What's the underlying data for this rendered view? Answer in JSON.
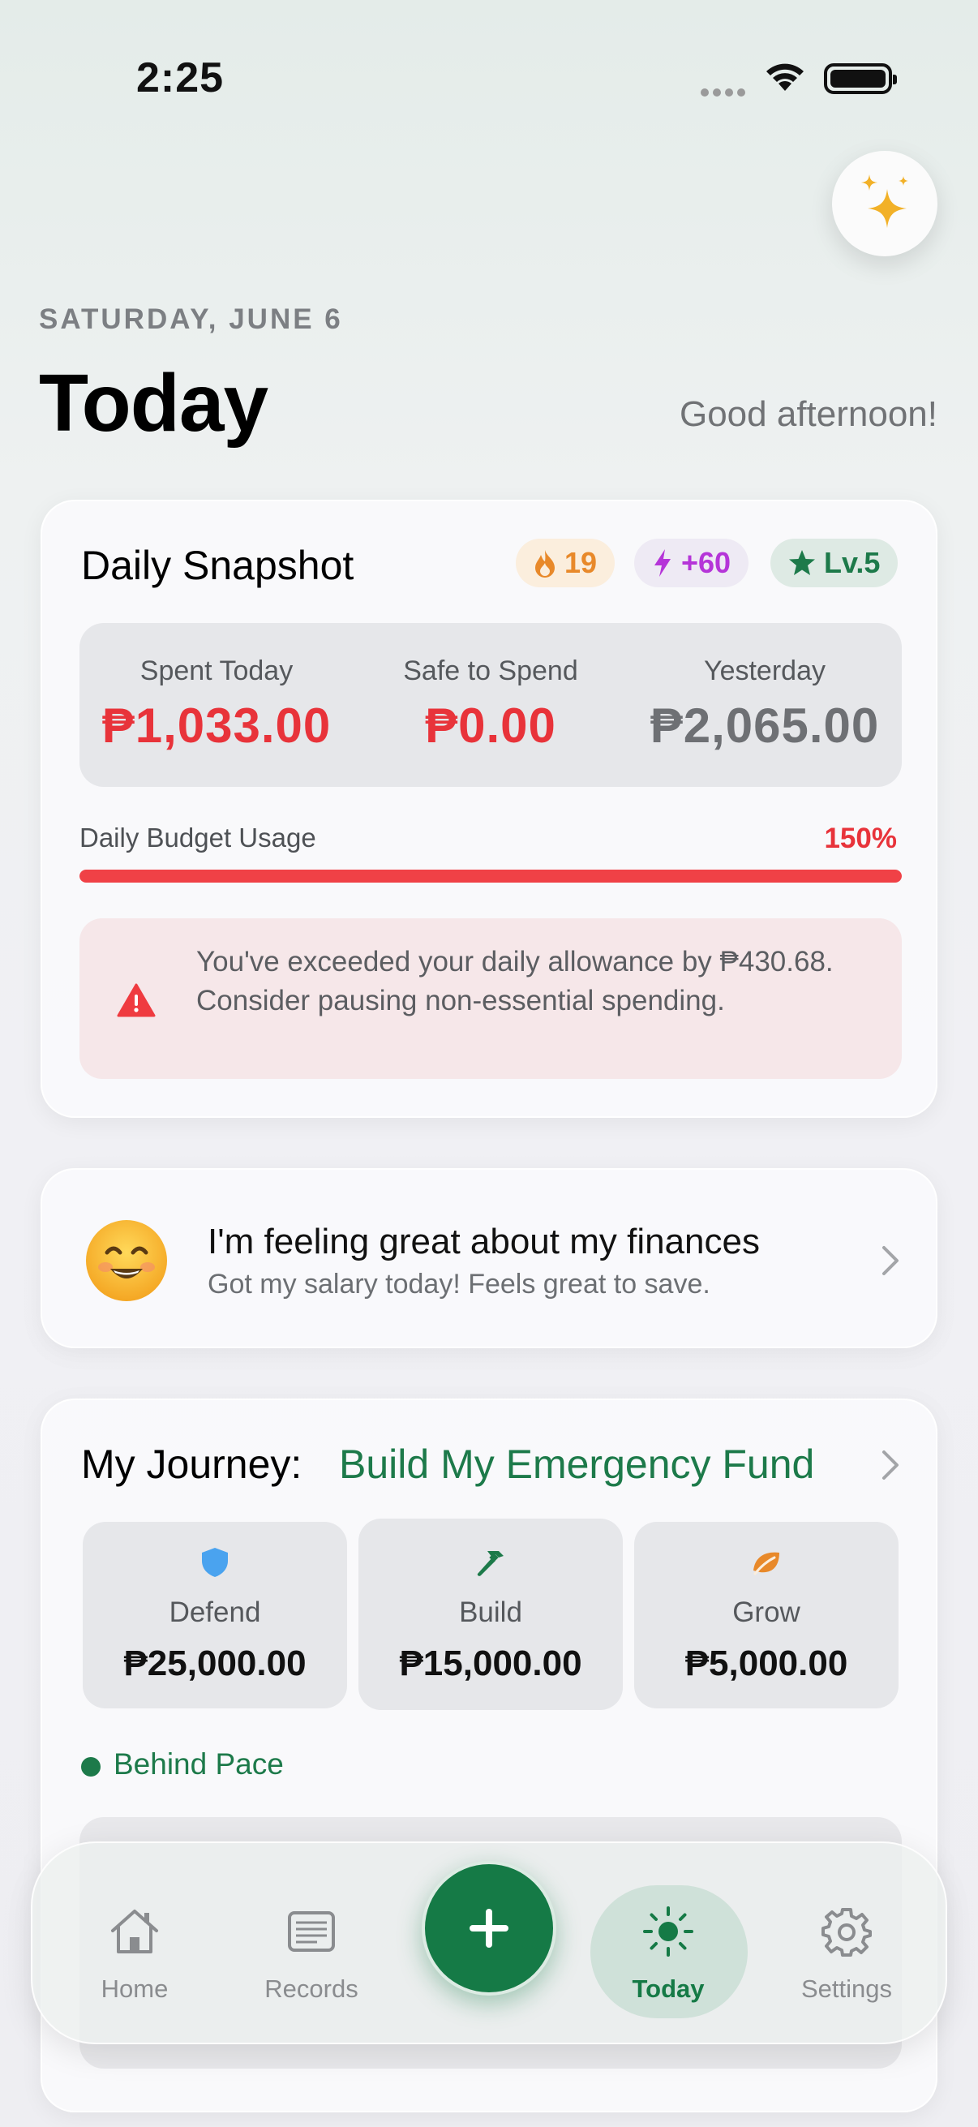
{
  "status_bar": {
    "time": "2:25"
  },
  "header": {
    "date": "SATURDAY, JUNE 6",
    "title": "Today",
    "greeting": "Good afternoon!"
  },
  "snapshot": {
    "title": "Daily Snapshot",
    "badges": {
      "streak": "19",
      "xp": "+60",
      "level": "Lv.5"
    },
    "stats": [
      {
        "label": "Spent Today",
        "value": "₱1,033.00",
        "color": "#e8333a"
      },
      {
        "label": "Safe to Spend",
        "value": "₱0.00",
        "color": "#e8333a"
      },
      {
        "label": "Yesterday",
        "value": "₱2,065.00",
        "color": "#6e7074"
      }
    ],
    "usage_label": "Daily Budget Usage",
    "usage_percent_text": "150%",
    "usage_fill_fraction": 1.0,
    "warning": "You've exceeded your daily allowance by ₱430.68. Consider pausing non-essential spending."
  },
  "mood": {
    "emoji": "smiling-face-icon",
    "title": "I'm feeling great about my finances",
    "subtitle": "Got my salary today! Feels great to save."
  },
  "journey": {
    "label": "My Journey:",
    "goal": "Build My Emergency Fund",
    "buckets": [
      {
        "label": "Defend",
        "value": "₱25,000.00",
        "icon": "shield-icon",
        "color": "#4aa3ef"
      },
      {
        "label": "Build",
        "value": "₱15,000.00",
        "icon": "hammer-icon",
        "color": "#1d7a4a"
      },
      {
        "label": "Grow",
        "value": "₱5,000.00",
        "icon": "leaf-icon",
        "color": "#e8892a"
      }
    ],
    "pace": "Behind Pace"
  },
  "tab_bar": {
    "home": "Home",
    "records": "Records",
    "today": "Today",
    "settings": "Settings",
    "active": "today"
  },
  "colors": {
    "accent_green": "#157a46",
    "danger_red": "#e8333a"
  }
}
